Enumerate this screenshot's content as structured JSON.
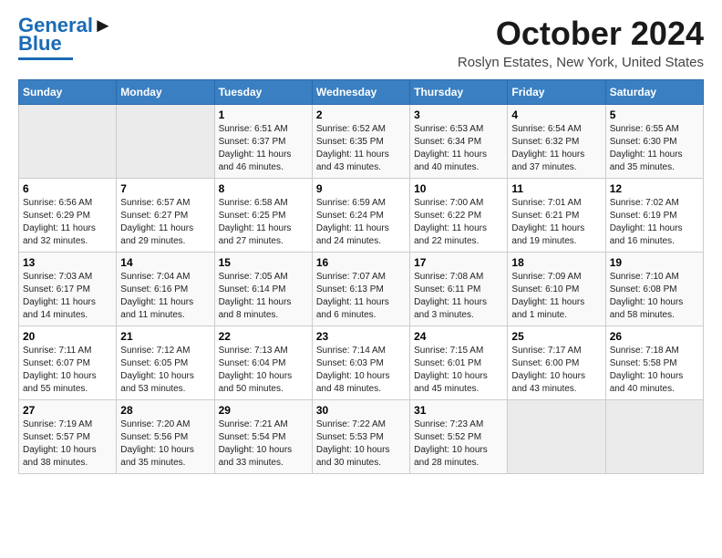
{
  "header": {
    "logo_line1": "General",
    "logo_line2": "Blue",
    "title": "October 2024",
    "subtitle": "Roslyn Estates, New York, United States"
  },
  "days_of_week": [
    "Sunday",
    "Monday",
    "Tuesday",
    "Wednesday",
    "Thursday",
    "Friday",
    "Saturday"
  ],
  "weeks": [
    [
      {
        "num": "",
        "detail": ""
      },
      {
        "num": "",
        "detail": ""
      },
      {
        "num": "1",
        "detail": "Sunrise: 6:51 AM\nSunset: 6:37 PM\nDaylight: 11 hours and 46 minutes."
      },
      {
        "num": "2",
        "detail": "Sunrise: 6:52 AM\nSunset: 6:35 PM\nDaylight: 11 hours and 43 minutes."
      },
      {
        "num": "3",
        "detail": "Sunrise: 6:53 AM\nSunset: 6:34 PM\nDaylight: 11 hours and 40 minutes."
      },
      {
        "num": "4",
        "detail": "Sunrise: 6:54 AM\nSunset: 6:32 PM\nDaylight: 11 hours and 37 minutes."
      },
      {
        "num": "5",
        "detail": "Sunrise: 6:55 AM\nSunset: 6:30 PM\nDaylight: 11 hours and 35 minutes."
      }
    ],
    [
      {
        "num": "6",
        "detail": "Sunrise: 6:56 AM\nSunset: 6:29 PM\nDaylight: 11 hours and 32 minutes."
      },
      {
        "num": "7",
        "detail": "Sunrise: 6:57 AM\nSunset: 6:27 PM\nDaylight: 11 hours and 29 minutes."
      },
      {
        "num": "8",
        "detail": "Sunrise: 6:58 AM\nSunset: 6:25 PM\nDaylight: 11 hours and 27 minutes."
      },
      {
        "num": "9",
        "detail": "Sunrise: 6:59 AM\nSunset: 6:24 PM\nDaylight: 11 hours and 24 minutes."
      },
      {
        "num": "10",
        "detail": "Sunrise: 7:00 AM\nSunset: 6:22 PM\nDaylight: 11 hours and 22 minutes."
      },
      {
        "num": "11",
        "detail": "Sunrise: 7:01 AM\nSunset: 6:21 PM\nDaylight: 11 hours and 19 minutes."
      },
      {
        "num": "12",
        "detail": "Sunrise: 7:02 AM\nSunset: 6:19 PM\nDaylight: 11 hours and 16 minutes."
      }
    ],
    [
      {
        "num": "13",
        "detail": "Sunrise: 7:03 AM\nSunset: 6:17 PM\nDaylight: 11 hours and 14 minutes."
      },
      {
        "num": "14",
        "detail": "Sunrise: 7:04 AM\nSunset: 6:16 PM\nDaylight: 11 hours and 11 minutes."
      },
      {
        "num": "15",
        "detail": "Sunrise: 7:05 AM\nSunset: 6:14 PM\nDaylight: 11 hours and 8 minutes."
      },
      {
        "num": "16",
        "detail": "Sunrise: 7:07 AM\nSunset: 6:13 PM\nDaylight: 11 hours and 6 minutes."
      },
      {
        "num": "17",
        "detail": "Sunrise: 7:08 AM\nSunset: 6:11 PM\nDaylight: 11 hours and 3 minutes."
      },
      {
        "num": "18",
        "detail": "Sunrise: 7:09 AM\nSunset: 6:10 PM\nDaylight: 11 hours and 1 minute."
      },
      {
        "num": "19",
        "detail": "Sunrise: 7:10 AM\nSunset: 6:08 PM\nDaylight: 10 hours and 58 minutes."
      }
    ],
    [
      {
        "num": "20",
        "detail": "Sunrise: 7:11 AM\nSunset: 6:07 PM\nDaylight: 10 hours and 55 minutes."
      },
      {
        "num": "21",
        "detail": "Sunrise: 7:12 AM\nSunset: 6:05 PM\nDaylight: 10 hours and 53 minutes."
      },
      {
        "num": "22",
        "detail": "Sunrise: 7:13 AM\nSunset: 6:04 PM\nDaylight: 10 hours and 50 minutes."
      },
      {
        "num": "23",
        "detail": "Sunrise: 7:14 AM\nSunset: 6:03 PM\nDaylight: 10 hours and 48 minutes."
      },
      {
        "num": "24",
        "detail": "Sunrise: 7:15 AM\nSunset: 6:01 PM\nDaylight: 10 hours and 45 minutes."
      },
      {
        "num": "25",
        "detail": "Sunrise: 7:17 AM\nSunset: 6:00 PM\nDaylight: 10 hours and 43 minutes."
      },
      {
        "num": "26",
        "detail": "Sunrise: 7:18 AM\nSunset: 5:58 PM\nDaylight: 10 hours and 40 minutes."
      }
    ],
    [
      {
        "num": "27",
        "detail": "Sunrise: 7:19 AM\nSunset: 5:57 PM\nDaylight: 10 hours and 38 minutes."
      },
      {
        "num": "28",
        "detail": "Sunrise: 7:20 AM\nSunset: 5:56 PM\nDaylight: 10 hours and 35 minutes."
      },
      {
        "num": "29",
        "detail": "Sunrise: 7:21 AM\nSunset: 5:54 PM\nDaylight: 10 hours and 33 minutes."
      },
      {
        "num": "30",
        "detail": "Sunrise: 7:22 AM\nSunset: 5:53 PM\nDaylight: 10 hours and 30 minutes."
      },
      {
        "num": "31",
        "detail": "Sunrise: 7:23 AM\nSunset: 5:52 PM\nDaylight: 10 hours and 28 minutes."
      },
      {
        "num": "",
        "detail": ""
      },
      {
        "num": "",
        "detail": ""
      }
    ]
  ]
}
